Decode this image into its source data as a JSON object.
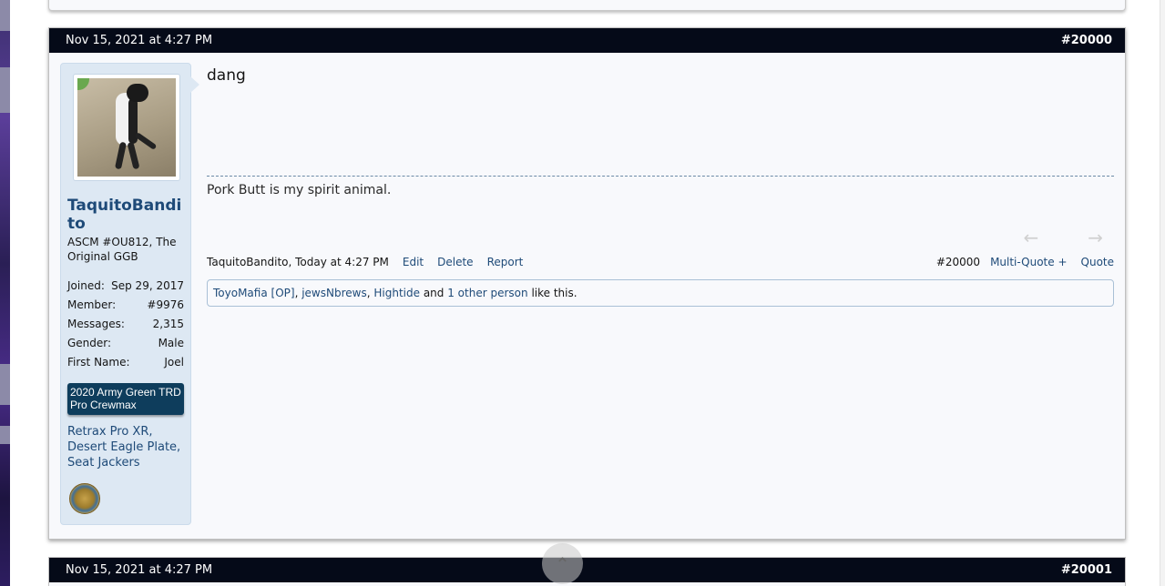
{
  "post": {
    "date": "Nov 15, 2021 at 4:27 PM",
    "number_hash": "#",
    "number": "20000",
    "message": "dang",
    "signature": "Pork Butt is my spirit animal.",
    "author": {
      "username": "TaquitoBandito",
      "title": "ASCM #OU812, The Original GGB",
      "stats": [
        {
          "label": "Joined:",
          "value": "Sep 29, 2017"
        },
        {
          "label": "Member:",
          "value": "#9976"
        },
        {
          "label": "Messages:",
          "value": "2,315"
        },
        {
          "label": "Gender:",
          "value": "Male"
        },
        {
          "label": "First Name:",
          "value": "Joel"
        }
      ],
      "vehicle": "2020 Army Green TRD Pro Crewmax",
      "mods": "Retrax Pro XR, Desert Eagle Plate, Seat Jackers",
      "avatar_icon": "cat-avatar",
      "badge_icon": "army-emblem-icon"
    },
    "meta": {
      "author_time": "TaquitoBandito, Today at 4:27 PM",
      "edit": "Edit",
      "delete": "Delete",
      "report": "Report",
      "post_ref": "#20000",
      "multi_quote": "Multi-Quote +",
      "quote": "Quote"
    },
    "likes": {
      "user1": "ToyoMafia [OP]",
      "sep1": ",",
      "user2": "jewsNbrews",
      "sep2": ",",
      "user3": "Hightide",
      "and": "and",
      "others": "1 other person",
      "suffix": "like this."
    }
  },
  "next_post": {
    "date": "Nov 15, 2021 at 4:27 PM",
    "number_hash": "#",
    "number": "20001"
  },
  "colors": {
    "header_bg": "#050a18",
    "link": "#1e4a78",
    "user_panel": "#dde8f3",
    "vehicle_banner": "#0e3d5c"
  }
}
